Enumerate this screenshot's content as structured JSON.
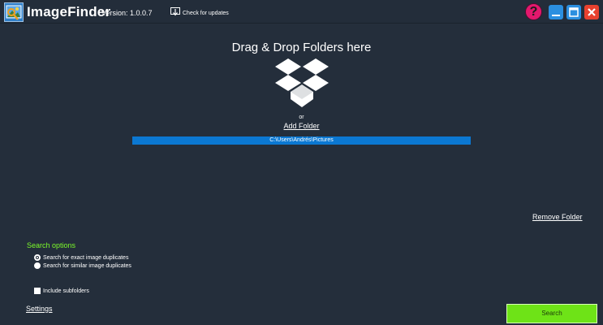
{
  "titlebar": {
    "app_name": "ImageFinder",
    "version": "Version: 1.0.0.7",
    "check_updates_label": "Check for updates",
    "help_label": "?",
    "icons": {
      "logo": "image-finder-logo-icon",
      "update": "download-monitor-icon",
      "help": "help-icon",
      "minimize": "minimize-icon",
      "maximize": "maximize-icon",
      "close": "close-icon"
    }
  },
  "dropzone": {
    "title": "Drag & Drop Folders here",
    "icon": "dropbox-icon",
    "or_label": "or",
    "add_folder_label": "Add Folder"
  },
  "folders": {
    "items": [
      {
        "path": "C:\\Users\\Andrés\\Pictures",
        "selected": true
      }
    ],
    "remove_label": "Remove Folder"
  },
  "search_options": {
    "heading": "Search options",
    "exact_label": "Search for exact image duplicates",
    "similar_label": "Search for similar image duplicates",
    "selected": "exact",
    "include_subfolders_label": "Include subfolders",
    "include_subfolders": false
  },
  "footer": {
    "settings_label": "Settings",
    "search_label": "Search"
  },
  "colors": {
    "background": "#242e3b",
    "accent_green": "#7cfb2a",
    "search_button": "#6ee317",
    "selection_blue": "#0b78d2",
    "help_pink": "#e3186d",
    "window_blue": "#2b8fe0",
    "close_red": "#e8412e"
  }
}
